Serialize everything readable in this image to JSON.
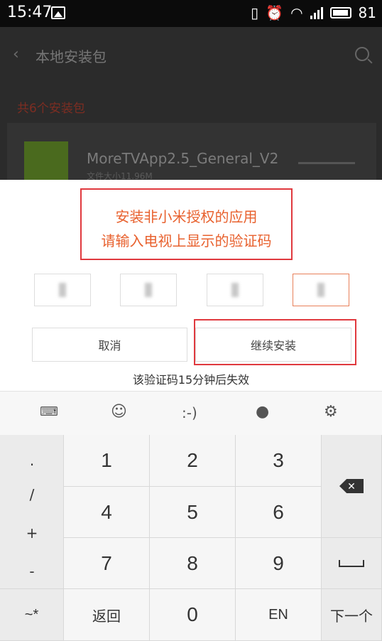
{
  "status_bar": {
    "time": "15:47",
    "battery": "81",
    "icons": [
      "image-icon",
      "vibrate-icon",
      "alarm-icon",
      "wifi-icon",
      "signal-icon",
      "battery-icon"
    ]
  },
  "background_app": {
    "title": "本地安装包",
    "section": "共6个安装包",
    "app_name": "MoreTVApp2.5_General_V2",
    "app_size": "文件大小11.96M"
  },
  "dialog": {
    "prompt_line1": "安装非小米授权的应用",
    "prompt_line2": "请输入电视上显示的验证码",
    "cancel_label": "取消",
    "continue_label": "继续安装",
    "expiry": "该验证码15分钟后失效"
  },
  "ime_toolbar": {
    "emoji_face": "☺",
    "emoticon": ":-)"
  },
  "keyboard": {
    "symbols": [
      ".",
      "/",
      "+",
      "-"
    ],
    "digits": [
      "1",
      "2",
      "3",
      "4",
      "5",
      "6",
      "7",
      "8",
      "9",
      "0"
    ],
    "bottom_left": "~*",
    "back_label": "返回",
    "en_label": "EN",
    "newline_label": "下一个"
  },
  "colors": {
    "accent": "#e8612e",
    "highlight": "#e0393e"
  }
}
